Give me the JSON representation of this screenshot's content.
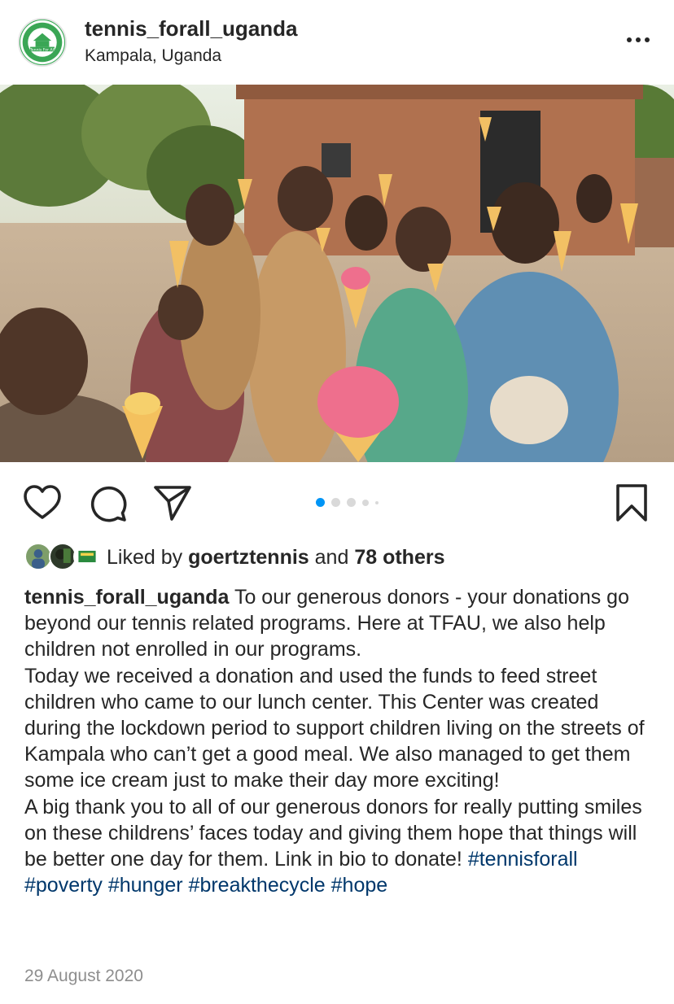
{
  "post": {
    "username": "tennis_forall_uganda",
    "location": "Kampala, Uganda",
    "avatar_icon": "tennis-for-all-logo",
    "avatar_logo_text": "Tennis For All",
    "photo_description_icon": "children-ice-cream-photo",
    "carousel": {
      "total": 5,
      "active_index": 0
    },
    "likes": {
      "prefix": "Liked by",
      "user": "goertztennis",
      "connector": "and",
      "others": "78 others"
    },
    "caption": {
      "user": "tennis_forall_uganda",
      "paragraph1": "To our generous donors - your donations go beyond our tennis related programs. Here at TFAU, we also help children not enrolled in our programs.",
      "paragraph2": "Today we received a donation and used the funds to feed street children who came to our lunch center. This Center was created during the lockdown period to support children living on the streets of Kampala who can’t get a good meal. We also managed to get them some ice cream just to make their day more exciting!",
      "paragraph3": "A big thank you to all of our generous donors for really putting smiles on these childrens’ faces today and giving them hope that things will be better one day for them. Link in bio to donate!",
      "hashtags": [
        "#tennisforall",
        "#poverty",
        "#hunger",
        "#breakthecycle",
        "#hope"
      ]
    },
    "date": "29 August 2020"
  },
  "colors": {
    "text": "#262626",
    "hashtag": "#00376b",
    "muted": "#8e8e8e",
    "carousel_active": "#0095f6"
  }
}
